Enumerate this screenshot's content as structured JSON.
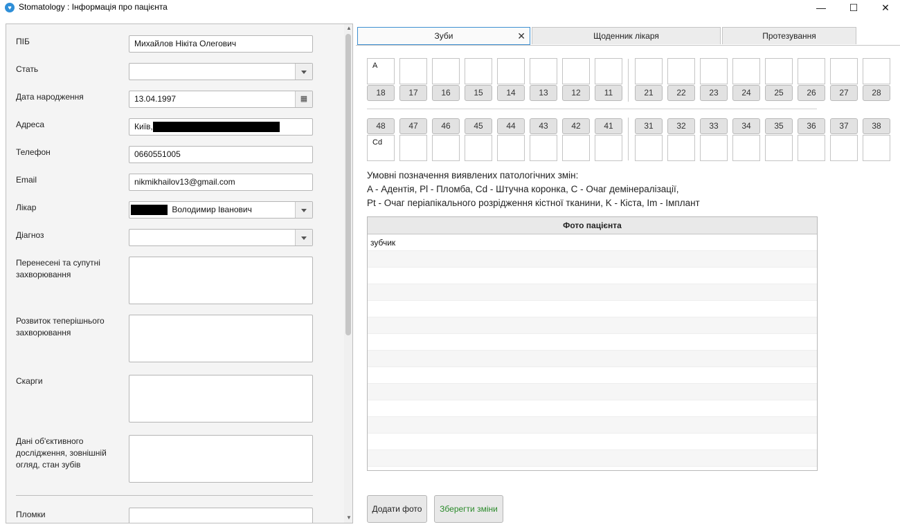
{
  "window": {
    "title": "Stomatology : Інформація про пацієнта",
    "minimize": "—",
    "maximize": "☐",
    "close": "✕"
  },
  "form": {
    "pib": {
      "label": "ПІБ",
      "value": "Михайлов Нікіта Олегович"
    },
    "sex": {
      "label": "Стать",
      "value": ""
    },
    "birth": {
      "label": "Дата народження",
      "value": "13.04.1997"
    },
    "address": {
      "label": "Адреса",
      "value": "Київ,"
    },
    "phone": {
      "label": "Телефон",
      "value": "0660551005"
    },
    "email": {
      "label": "Email",
      "value": "nikmikhailov13@gmail.com"
    },
    "doctor": {
      "label": "Лікар",
      "value": "Володимир Іванович"
    },
    "diagnosis": {
      "label": "Діагноз",
      "value": ""
    },
    "past_diseases": {
      "label1": "Перенесені та супутні",
      "label2": "захворювання"
    },
    "current_disease": {
      "label1": "Розвиток теперішнього",
      "label2": "захворювання"
    },
    "complaints": {
      "label": "Скарги"
    },
    "objective": {
      "label1": "Дані об'єктивного",
      "label2": "дослідження, зовнішній",
      "label3": "огляд, стан зубів"
    },
    "cut_label": "Пломки"
  },
  "tabs": [
    {
      "label": "Зуби",
      "close": "✕"
    },
    {
      "label": "Щоденник лікаря"
    },
    {
      "label": "Протезування"
    }
  ],
  "teeth": {
    "upper": [
      "18",
      "17",
      "16",
      "15",
      "14",
      "13",
      "12",
      "11",
      "21",
      "22",
      "23",
      "24",
      "25",
      "26",
      "27",
      "28"
    ],
    "upper_marks": [
      "A",
      "",
      "",
      "",
      "",
      "",
      "",
      "",
      "",
      "",
      "",
      "",
      "",
      "",
      "",
      ""
    ],
    "lower": [
      "48",
      "47",
      "46",
      "45",
      "44",
      "43",
      "42",
      "41",
      "31",
      "32",
      "33",
      "34",
      "35",
      "36",
      "37",
      "38"
    ],
    "lower_marks": [
      "Cd",
      "",
      "",
      "",
      "",
      "",
      "",
      "",
      "",
      "",
      "",
      "",
      "",
      "",
      "",
      ""
    ]
  },
  "legend": {
    "line1": "Умовні позначення виявлених патологічних змін:",
    "line2": "A - Адентія, Pl - Пломба, Cd - Штучна коронка, C - Очаг демінералізації,",
    "line3": "Pt - Очаг періапікального розрідження кістної тканини, K - Кіста, Im - Імплант"
  },
  "photos": {
    "header": "Фото пацієнта",
    "rows": [
      "зубчик"
    ]
  },
  "buttons": {
    "add_photo": "Додати фото",
    "save": "Зберегти зміни"
  },
  "colors": {
    "accent": "#3d8fd1",
    "save_text": "#2a8a2a"
  }
}
